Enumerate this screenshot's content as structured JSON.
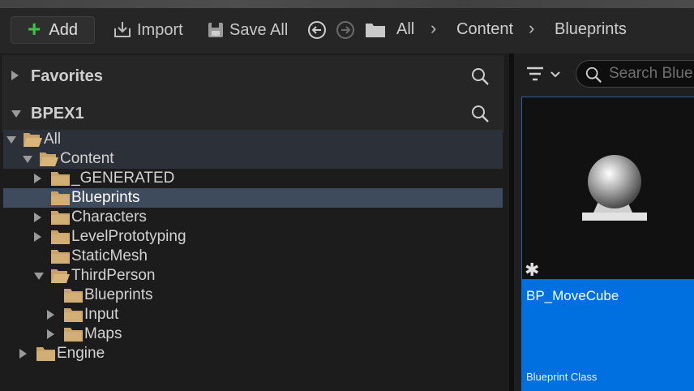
{
  "toolbar": {
    "add_label": "Add",
    "import_label": "Import",
    "save_all_label": "Save All",
    "breadcrumbs": [
      "All",
      "Content",
      "Blueprints"
    ]
  },
  "sections": {
    "favorites": "Favorites",
    "project": "BPEX1"
  },
  "tree": [
    {
      "label": "All",
      "expanded": true,
      "highlight": true
    },
    {
      "label": "Content",
      "expanded": true,
      "highlight": true
    },
    {
      "label": "_GENERATED",
      "expanded": false
    },
    {
      "label": "Blueprints",
      "selected": true
    },
    {
      "label": "Characters",
      "expanded": false
    },
    {
      "label": "LevelPrototyping",
      "expanded": false
    },
    {
      "label": "StaticMesh"
    },
    {
      "label": "ThirdPerson",
      "expanded": true
    },
    {
      "label": "Blueprints"
    },
    {
      "label": "Input",
      "expanded": false
    },
    {
      "label": "Maps",
      "expanded": false
    },
    {
      "label": "Engine",
      "expanded": false
    }
  ],
  "search": {
    "placeholder": "Search Blue"
  },
  "asset": {
    "name": "BP_MoveCube",
    "type": "Blueprint Class",
    "icon": "sphere-on-pedestal-icon"
  },
  "colors": {
    "accent": "#0070e0",
    "selection": "#3d4b5d",
    "folder": "#c9a36a",
    "add_plus": "#3fc24a"
  }
}
